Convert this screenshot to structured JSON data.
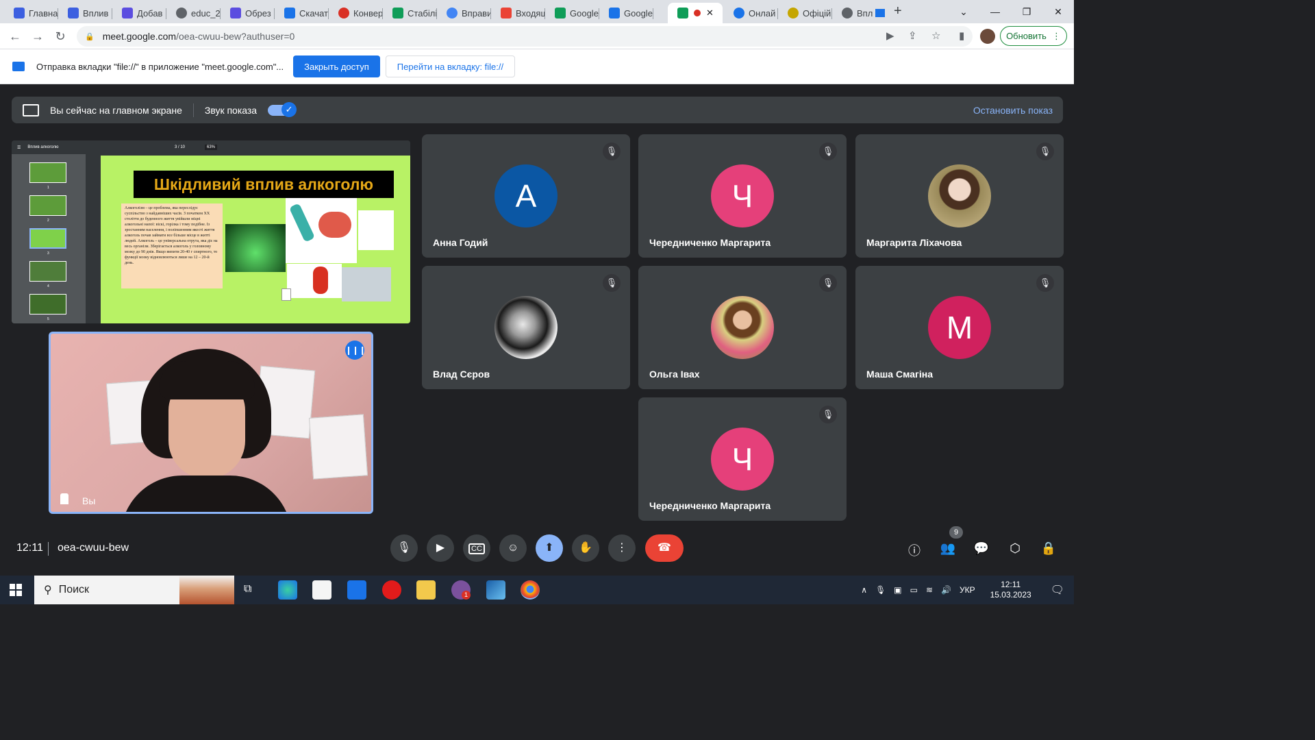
{
  "browser": {
    "tabs": [
      {
        "label": "Главна",
        "color": "#3c5fe0"
      },
      {
        "label": "Вплив",
        "color": "#3c5fe0"
      },
      {
        "label": "Добав",
        "color": "#5b4de0"
      },
      {
        "label": "educ_2",
        "color": "#5f6368"
      },
      {
        "label": "Обрез",
        "color": "#5b4de0"
      },
      {
        "label": "Скачат",
        "color": "#1a73e8"
      },
      {
        "label": "Конвер",
        "color": "#d93025"
      },
      {
        "label": "Стабілі",
        "color": "#0f9d58"
      },
      {
        "label": "Вправи",
        "color": "#4285f4"
      },
      {
        "label": "Входящ",
        "color": "#ea4335"
      },
      {
        "label": "Google",
        "color": "#0f9d58"
      },
      {
        "label": "Google",
        "color": "#1a73e8"
      },
      {
        "label": "",
        "color": "#0f9d58"
      },
      {
        "label": "Онлай",
        "color": "#1a73e8"
      },
      {
        "label": "Офіцій",
        "color": "#c5a600"
      },
      {
        "label": "Впл",
        "color": "#5f6368"
      }
    ],
    "new_tab_label": "+",
    "url_host": "meet.google.com",
    "url_path": "/oea-cwuu-bew?authuser=0",
    "update_label": "Обновить"
  },
  "infobar": {
    "message": "Отправка вкладки \"file://\" в приложение \"meet.google.com\"...",
    "close_access_label": "Закрыть доступ",
    "goto_tab_label": "Перейти на вкладку: file://"
  },
  "presenting": {
    "status": "Вы сейчас на главном экране",
    "audio_label": "Звук показа",
    "stop_label": "Остановить показ"
  },
  "slide": {
    "doc_title": "Вплив алкоголю",
    "page": "3 / 10",
    "zoom": "63%",
    "title": "Шкідливий вплив алкоголю",
    "thumb_numbers": [
      "1",
      "2",
      "3",
      "4",
      "5"
    ],
    "text": "Алкоголізм – це проблема, яка переслідує суспільство з найдавніших часів. З початком XX століття до буденного життя увійшли міцні алкогольні напої: віскі, горілка і тому подібне. Із зростанням населення, і поліпшенням якості життя алкоголь почав займати все більше місце в житті людей. Алкоголь – це універсальна отрута, яка діє на весь організм. Зберігається алкоголь у головному мозку до 90 днів. Якщо випити 20-40 г спиртного, то функції мозку відновлюються лише на 12 – 20-й день."
  },
  "self_view": {
    "label": "Вы"
  },
  "participants": [
    {
      "name": "Анна Годий",
      "initial": "А",
      "color": "#0b57a4"
    },
    {
      "name": "Чередниченко Маргарита",
      "initial": "Ч",
      "color": "#e5407a"
    },
    {
      "name": "Маргарита Ліхачова",
      "initial": "",
      "color": "#8a7a5a"
    },
    {
      "name": "Влад Сєров",
      "initial": "",
      "color": "#222222"
    },
    {
      "name": "Ольга Івах",
      "initial": "",
      "color": "#9a7a3a"
    },
    {
      "name": "Маша Смагіна",
      "initial": "М",
      "color": "#d0215e"
    },
    {
      "name": "Чередниченко Маргарита",
      "initial": "Ч",
      "color": "#e5407a"
    }
  ],
  "meeting": {
    "time": "12:11",
    "code": "oea-cwuu-bew",
    "participant_count": "9"
  },
  "taskbar": {
    "search_placeholder": "Поиск",
    "language": "УКР",
    "time": "12:11",
    "date": "15.03.2023",
    "viber_badge": "1"
  }
}
